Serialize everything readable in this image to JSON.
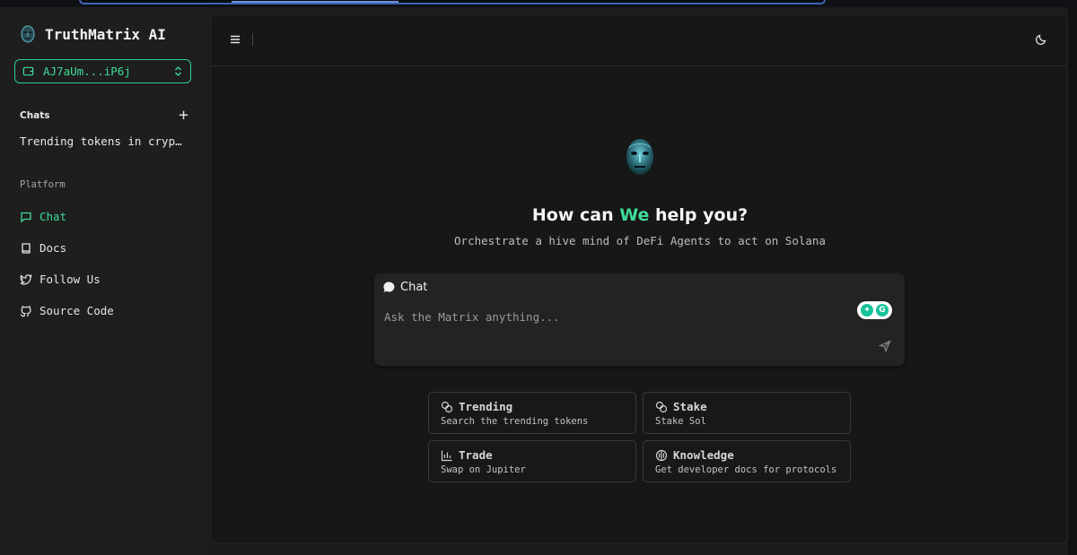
{
  "app": {
    "name": "TruthMatrix AI",
    "accent_color": "#3ddc97",
    "logo_icon": "robot-face-icon"
  },
  "wallet": {
    "address": "AJ7aUm...iP6j",
    "icon": "wallet-icon",
    "toggle_icon": "chevrons-up-down-icon"
  },
  "chats": {
    "header": "Chats",
    "add_icon": "plus-icon",
    "items": [
      "Trending tokens in cryp…"
    ]
  },
  "platform": {
    "header": "Platform",
    "items": [
      {
        "label": "Chat",
        "icon": "message-square-icon",
        "active": true
      },
      {
        "label": "Docs",
        "icon": "book-icon",
        "active": false
      },
      {
        "label": "Follow Us",
        "icon": "twitter-icon",
        "active": false
      },
      {
        "label": "Source Code",
        "icon": "github-icon",
        "active": false
      }
    ]
  },
  "header": {
    "menu_icon": "menu-icon",
    "theme_icon": "moon-icon"
  },
  "hero": {
    "title_before": "How can ",
    "title_accent": "We",
    "title_after": " help you?",
    "subtitle": "Orchestrate a hive mind of DeFi Agents to act on Solana"
  },
  "chat_input": {
    "mode_label": "Chat",
    "placeholder": "Ask the Matrix anything...",
    "value": "",
    "send_icon": "send-icon"
  },
  "suggestions": [
    {
      "title": "Trending",
      "description": "Search the trending tokens",
      "icon": "coins-icon"
    },
    {
      "title": "Stake",
      "description": "Stake Sol",
      "icon": "coins-icon"
    },
    {
      "title": "Trade",
      "description": "Swap on Jupiter",
      "icon": "chart-icon"
    },
    {
      "title": "Knowledge",
      "description": "Get developer docs for protocols",
      "icon": "brain-icon"
    }
  ]
}
